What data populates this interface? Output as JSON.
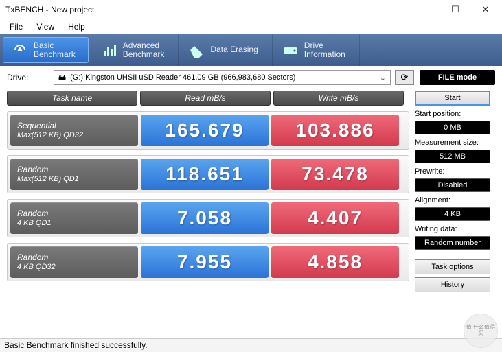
{
  "window": {
    "title": "TxBENCH - New project"
  },
  "menu": [
    "File",
    "View",
    "Help"
  ],
  "tabs": [
    {
      "label": "Basic\nBenchmark",
      "active": true
    },
    {
      "label": "Advanced\nBenchmark"
    },
    {
      "label": "Data Erasing"
    },
    {
      "label": "Drive\nInformation"
    }
  ],
  "driveRow": {
    "label": "Drive:",
    "selected": "(G:) Kingston UHSII uSD Reader  461.09 GB  (966,983,680 Sectors)"
  },
  "fileMode": "FILE mode",
  "headers": {
    "task": "Task name",
    "read": "Read mB/s",
    "write": "Write mB/s"
  },
  "rows": [
    {
      "task": "Sequential",
      "sub": "Max(512 KB) QD32",
      "read": "165.679",
      "write": "103.886"
    },
    {
      "task": "Random",
      "sub": "Max(512 KB) QD1",
      "read": "118.651",
      "write": "73.478"
    },
    {
      "task": "Random",
      "sub": "4 KB QD1",
      "read": "7.058",
      "write": "4.407"
    },
    {
      "task": "Random",
      "sub": "4 KB QD32",
      "read": "7.955",
      "write": "4.858"
    }
  ],
  "side": {
    "start": "Start",
    "startPosLabel": "Start position:",
    "startPos": "0 MB",
    "measSizeLabel": "Measurement size:",
    "measSize": "512 MB",
    "prewriteLabel": "Prewrite:",
    "prewrite": "Disabled",
    "alignLabel": "Alignment:",
    "align": "4 KB",
    "writingDataLabel": "Writing data:",
    "writingData": "Random number",
    "taskOptions": "Task options",
    "history": "History"
  },
  "status": "Basic Benchmark finished successfully.",
  "watermark": "值 什么值得买"
}
